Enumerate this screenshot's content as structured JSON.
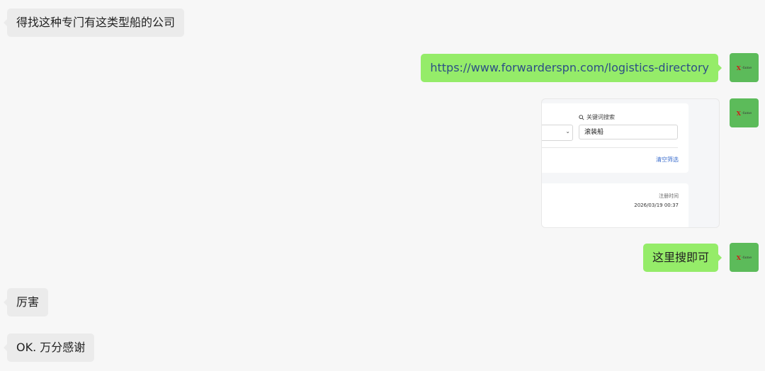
{
  "messages": [
    {
      "side": "left",
      "text": "得找这种专门有这类型船的公司"
    },
    {
      "side": "right",
      "text": "https://www.forwarderspn.com/logistics-directory"
    },
    {
      "side": "right",
      "type": "image"
    },
    {
      "side": "right",
      "text": "这里搜即可"
    },
    {
      "side": "left",
      "text": "厉害"
    },
    {
      "side": "left",
      "text": "OK. 万分感谢"
    }
  ],
  "avatar": {
    "logo_main": "X",
    "logo_small": "-fame"
  },
  "screenshot": {
    "search_label": "关键词搜索",
    "search_value": "滚装船",
    "clear_filter": "清空筛选",
    "register_time_label": "注册时间",
    "register_time_value": "2026/03/19 00:37"
  },
  "colors": {
    "background": "#f7f7f7",
    "bubble_left": "#ebebeb",
    "bubble_right": "#95ec69",
    "avatar_bg": "#5cbb5a",
    "link_text": "#2d4e86"
  }
}
